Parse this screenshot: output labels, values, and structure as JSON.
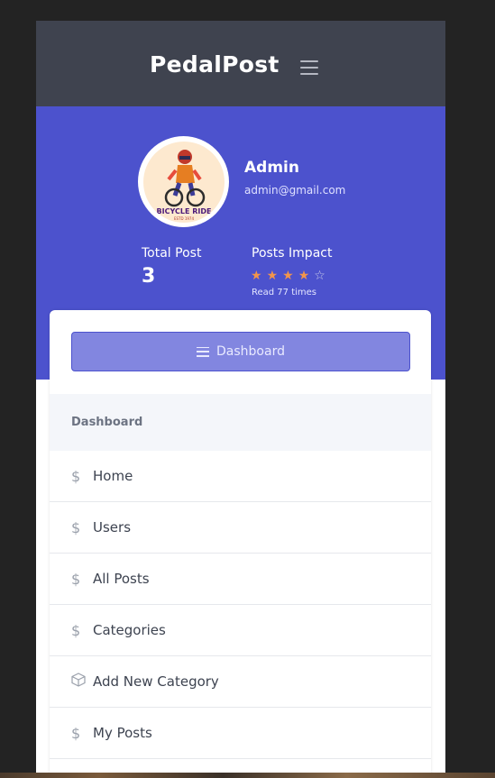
{
  "header": {
    "brand": "PedalPost"
  },
  "profile": {
    "name": "Admin",
    "email": "admin@gmail.com",
    "avatar_text": "BICYCLE RIDE",
    "avatar_subtext": "ESTD 1974",
    "total_post_label": "Total Post",
    "total_post_value": "3",
    "impact_label": "Posts Impact",
    "rating": 4,
    "rating_max": 5,
    "read_text": "Read 77 times"
  },
  "dashboard_button": {
    "label": "Dashboard"
  },
  "sidebar": {
    "section_title": "Dashboard",
    "items": [
      {
        "label": "Home",
        "icon": "dollar-icon"
      },
      {
        "label": "Users",
        "icon": "dollar-icon"
      },
      {
        "label": "All Posts",
        "icon": "dollar-icon"
      },
      {
        "label": "Categories",
        "icon": "dollar-icon"
      },
      {
        "label": "Add New Category",
        "icon": "box-icon"
      },
      {
        "label": "My Posts",
        "icon": "dollar-icon"
      }
    ]
  },
  "colors": {
    "topbar": "#3f434f",
    "profile_bg": "#4c52cd",
    "star_filled": "#f3954b",
    "button_bg": "#8286e0"
  }
}
